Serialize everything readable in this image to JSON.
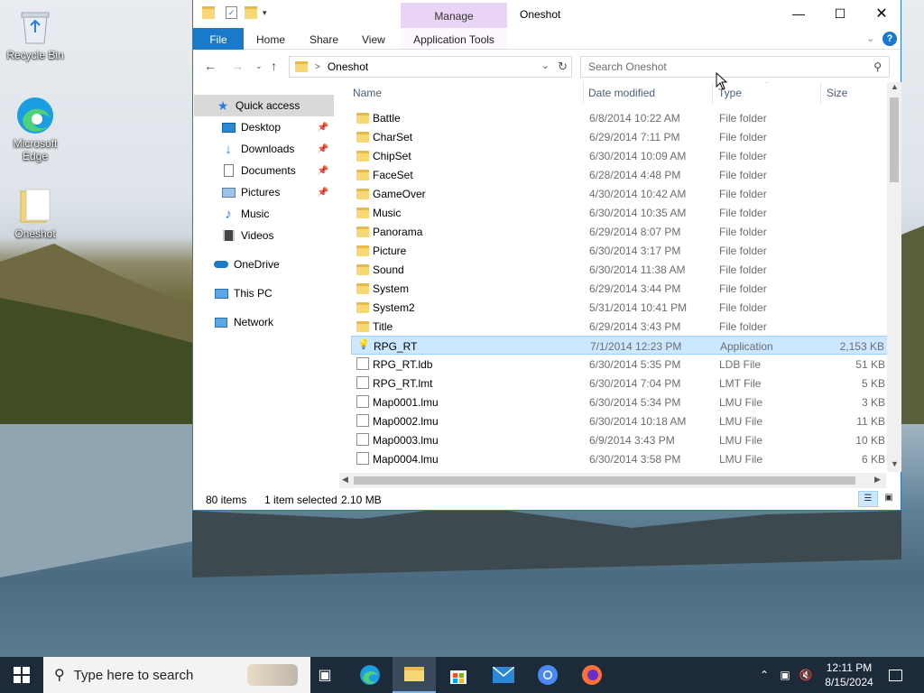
{
  "desktop": {
    "icons": [
      {
        "label": "Recycle Bin"
      },
      {
        "label": "Microsoft Edge"
      },
      {
        "label": "Oneshot"
      }
    ]
  },
  "window": {
    "title": "Oneshot",
    "contextual_tab": "Manage",
    "ribbon_tabs": [
      "File",
      "Home",
      "Share",
      "View",
      "Application Tools"
    ],
    "address": "Oneshot",
    "search_placeholder": "Search Oneshot",
    "help_glyph": "?"
  },
  "nav": {
    "quick_access": "Quick access",
    "items": [
      {
        "label": "Desktop"
      },
      {
        "label": "Downloads"
      },
      {
        "label": "Documents"
      },
      {
        "label": "Pictures"
      },
      {
        "label": "Music"
      },
      {
        "label": "Videos"
      }
    ],
    "onedrive": "OneDrive",
    "this_pc": "This PC",
    "network": "Network"
  },
  "columns": {
    "name": "Name",
    "date": "Date modified",
    "type": "Type",
    "size": "Size"
  },
  "files": [
    {
      "name": "Battle",
      "date": "6/8/2014 10:22 AM",
      "type": "File folder",
      "size": "",
      "kind": "folder"
    },
    {
      "name": "CharSet",
      "date": "6/29/2014 7:11 PM",
      "type": "File folder",
      "size": "",
      "kind": "folder"
    },
    {
      "name": "ChipSet",
      "date": "6/30/2014 10:09 AM",
      "type": "File folder",
      "size": "",
      "kind": "folder"
    },
    {
      "name": "FaceSet",
      "date": "6/28/2014 4:48 PM",
      "type": "File folder",
      "size": "",
      "kind": "folder"
    },
    {
      "name": "GameOver",
      "date": "4/30/2014 10:42 AM",
      "type": "File folder",
      "size": "",
      "kind": "folder"
    },
    {
      "name": "Music",
      "date": "6/30/2014 10:35 AM",
      "type": "File folder",
      "size": "",
      "kind": "folder"
    },
    {
      "name": "Panorama",
      "date": "6/29/2014 8:07 PM",
      "type": "File folder",
      "size": "",
      "kind": "folder"
    },
    {
      "name": "Picture",
      "date": "6/30/2014 3:17 PM",
      "type": "File folder",
      "size": "",
      "kind": "folder"
    },
    {
      "name": "Sound",
      "date": "6/30/2014 11:38 AM",
      "type": "File folder",
      "size": "",
      "kind": "folder"
    },
    {
      "name": "System",
      "date": "6/29/2014 3:44 PM",
      "type": "File folder",
      "size": "",
      "kind": "folder"
    },
    {
      "name": "System2",
      "date": "5/31/2014 10:41 PM",
      "type": "File folder",
      "size": "",
      "kind": "folder"
    },
    {
      "name": "Title",
      "date": "6/29/2014 3:43 PM",
      "type": "File folder",
      "size": "",
      "kind": "folder"
    },
    {
      "name": "RPG_RT",
      "date": "7/1/2014 12:23 PM",
      "type": "Application",
      "size": "2,153 KB",
      "kind": "app",
      "selected": true
    },
    {
      "name": "RPG_RT.ldb",
      "date": "6/30/2014 5:35 PM",
      "type": "LDB File",
      "size": "51 KB",
      "kind": "file"
    },
    {
      "name": "RPG_RT.lmt",
      "date": "6/30/2014 7:04 PM",
      "type": "LMT File",
      "size": "5 KB",
      "kind": "file"
    },
    {
      "name": "Map0001.lmu",
      "date": "6/30/2014 5:34 PM",
      "type": "LMU File",
      "size": "3 KB",
      "kind": "file"
    },
    {
      "name": "Map0002.lmu",
      "date": "6/30/2014 10:18 AM",
      "type": "LMU File",
      "size": "11 KB",
      "kind": "file"
    },
    {
      "name": "Map0003.lmu",
      "date": "6/9/2014 3:43 PM",
      "type": "LMU File",
      "size": "10 KB",
      "kind": "file"
    },
    {
      "name": "Map0004.lmu",
      "date": "6/30/2014 3:58 PM",
      "type": "LMU File",
      "size": "6 KB",
      "kind": "file"
    }
  ],
  "status": {
    "item_count": "80 items",
    "selection": "1 item selected",
    "selection_size": "2.10 MB"
  },
  "taskbar": {
    "search_placeholder": "Type here to search",
    "time": "12:11 PM",
    "date": "8/15/2024"
  },
  "colors": {
    "accent": "#1979ca",
    "selection": "#cce8ff",
    "manage_tab": "#e9d4f5",
    "taskbar": "#1c2a3a"
  }
}
